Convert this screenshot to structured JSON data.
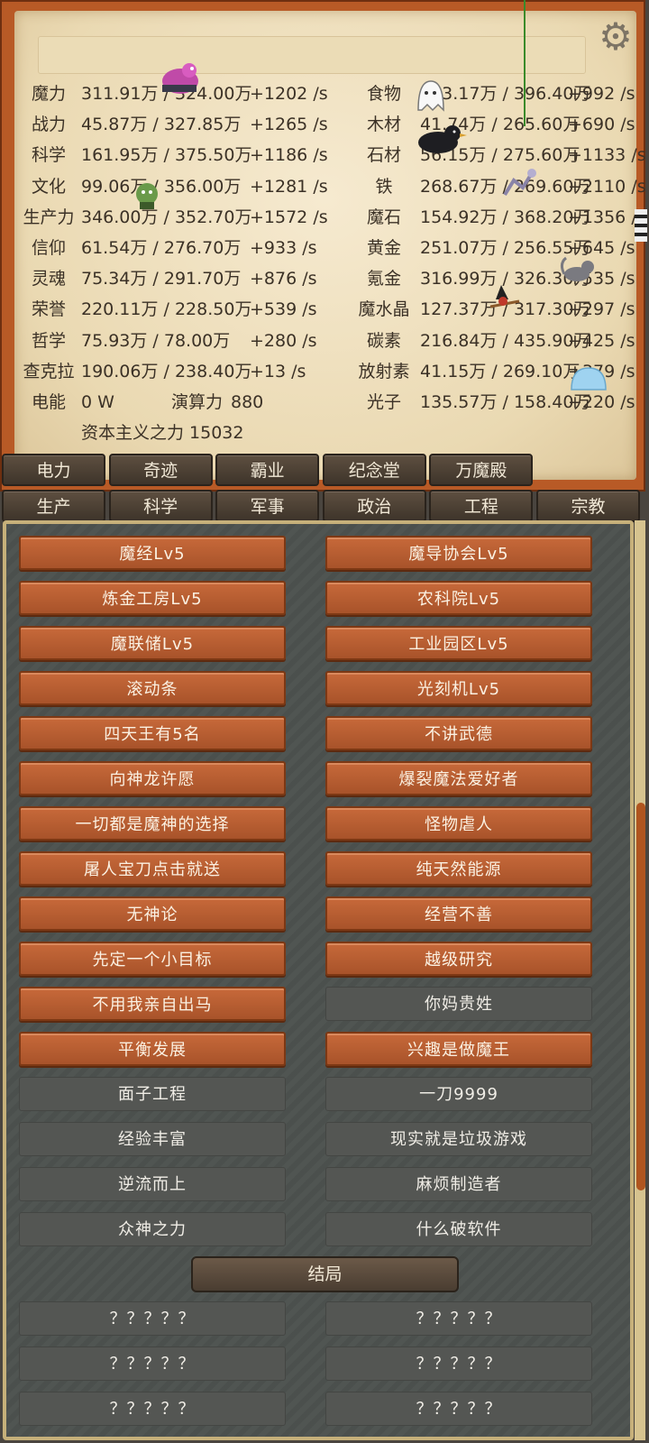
{
  "resources_left": [
    {
      "name": "魔力",
      "value": "311.91万 / 324.00万",
      "rate": "+1202 /s"
    },
    {
      "name": "战力",
      "value": "45.87万 / 327.85万",
      "rate": "+1265 /s"
    },
    {
      "name": "科学",
      "value": "161.95万 / 375.50万",
      "rate": "+1186 /s"
    },
    {
      "name": "文化",
      "value": "99.06万 / 356.00万",
      "rate": "+1281 /s"
    },
    {
      "name": "生产力",
      "value": "346.00万 / 352.70万",
      "rate": "+1572 /s"
    },
    {
      "name": "信仰",
      "value": "61.54万 / 276.70万",
      "rate": "+933 /s"
    },
    {
      "name": "灵魂",
      "value": "75.34万 / 291.70万",
      "rate": "+876 /s"
    },
    {
      "name": "荣誉",
      "value": "220.11万 / 228.50万",
      "rate": "+539 /s"
    },
    {
      "name": "哲学",
      "value": "75.93万 / 78.00万",
      "rate": "+280 /s"
    },
    {
      "name": "查克拉",
      "value": "190.06万 / 238.40万",
      "rate": "+13 /s"
    }
  ],
  "resources_right": [
    {
      "name": "食物",
      "value": "233.17万 / 396.40万",
      "rate": "+992 /s"
    },
    {
      "name": "木材",
      "value": "41.74万 / 265.60万",
      "rate": "+690 /s"
    },
    {
      "name": "石材",
      "value": "56.15万 / 275.60万",
      "rate": "+1133 /s"
    },
    {
      "name": "铁",
      "value": "268.67万 / 269.60万",
      "rate": "+2110 /s"
    },
    {
      "name": "魔石",
      "value": "154.92万 / 368.20万",
      "rate": "+1356 /s"
    },
    {
      "name": "黄金",
      "value": "251.07万 / 256.55万",
      "rate": "+645 /s"
    },
    {
      "name": "氪金",
      "value": "316.99万 / 326.30万",
      "rate": "+535 /s"
    },
    {
      "name": "魔水晶",
      "value": "127.37万 / 317.30万",
      "rate": "+297 /s"
    },
    {
      "name": "碳素",
      "value": "216.84万 / 435.90万",
      "rate": "+425 /s"
    },
    {
      "name": "放射素",
      "value": "41.15万 / 269.10万",
      "rate": "+379 /s"
    },
    {
      "name": "光子",
      "value": "135.57万 / 158.40万",
      "rate": "+220 /s"
    }
  ],
  "power": {
    "label": "电能",
    "value": "0 W"
  },
  "compute": {
    "label": "演算力",
    "value": "880"
  },
  "capitalism": "资本主义之力 15032",
  "tabs_row1": [
    "电力",
    "奇迹",
    "霸业",
    "纪念堂",
    "万魔殿"
  ],
  "tabs_row2": [
    "生产",
    "科学",
    "军事",
    "政治",
    "工程",
    "宗教"
  ],
  "achievements": [
    [
      "魔经Lv5",
      "魔导协会Lv5"
    ],
    [
      "炼金工房Lv5",
      "农科院Lv5"
    ],
    [
      "魔联储Lv5",
      "工业园区Lv5"
    ],
    [
      "滚动条",
      "光刻机Lv5"
    ],
    [
      "四天王有5名",
      "不讲武德"
    ],
    [
      "向神龙许愿",
      "爆裂魔法爱好者"
    ],
    [
      "一切都是魔神的选择",
      "怪物虐人"
    ],
    [
      "屠人宝刀点击就送",
      "纯天然能源"
    ],
    [
      "无神论",
      "经营不善"
    ],
    [
      "先定一个小目标",
      "越级研究"
    ],
    [
      "不用我亲自出马",
      "你妈贵姓"
    ],
    [
      "平衡发展",
      "兴趣是做魔王"
    ],
    [
      "面子工程",
      "一刀9999"
    ],
    [
      "经验丰富",
      "现实就是垃圾游戏"
    ],
    [
      "逆流而上",
      "麻烦制造者"
    ],
    [
      "众神之力",
      "什么破软件"
    ]
  ],
  "achievements_unlocked": [
    [
      true,
      true
    ],
    [
      true,
      true
    ],
    [
      true,
      true
    ],
    [
      true,
      true
    ],
    [
      true,
      true
    ],
    [
      true,
      true
    ],
    [
      true,
      true
    ],
    [
      true,
      true
    ],
    [
      true,
      true
    ],
    [
      true,
      true
    ],
    [
      true,
      false
    ],
    [
      true,
      true
    ],
    [
      false,
      false
    ],
    [
      false,
      false
    ],
    [
      false,
      false
    ],
    [
      false,
      false
    ]
  ],
  "ending_label": "结局",
  "endings": [
    [
      "？？？？？",
      "？？？？？"
    ],
    [
      "？？？？？",
      "？？？？？"
    ],
    [
      "？？？？？",
      "？？？？？"
    ]
  ],
  "colors": {
    "frame": "#b85a26",
    "parchment": "#efe1bd",
    "button_unlocked": "#b85f31",
    "button_locked": "#545653",
    "tab": "#4e4236",
    "stone": "#4d524f"
  },
  "icons": [
    "gear-icon"
  ]
}
